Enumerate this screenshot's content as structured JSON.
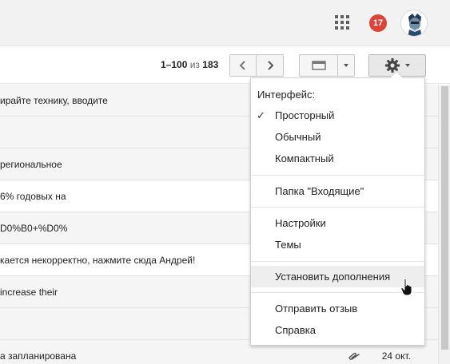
{
  "header": {
    "apps_icon": "apps-grid-icon",
    "notification_count": "17",
    "avatar_icon": "user-avatar"
  },
  "toolbar": {
    "range": "1–100",
    "of": "из",
    "total": "183",
    "prev_icon": "chevron-left-icon",
    "next_icon": "chevron-right-icon",
    "density_icon": "display-density-icon",
    "settings_icon": "gear-icon"
  },
  "mail_rows": [
    {
      "snippet": "ирайте технику, вводите",
      "date": ""
    },
    {
      "snippet": "",
      "date": ""
    },
    {
      "snippet": " региональное",
      "date": ""
    },
    {
      "snippet": "6% годовых на",
      "date": ""
    },
    {
      "snippet": "D0%B0+%D0%",
      "date": ""
    },
    {
      "snippet": "кается некорректно, нажмите сюда Андрей!",
      "date": ""
    },
    {
      "snippet": " increase their",
      "date": ""
    },
    {
      "snippet": "",
      "date": ""
    },
    {
      "snippet": "а запланирована",
      "date": "24 окт."
    }
  ],
  "settings_menu": {
    "heading": "Интерфейс:",
    "density_options": [
      {
        "label": "Просторный",
        "checked": true
      },
      {
        "label": "Обычный",
        "checked": false
      },
      {
        "label": "Компактный",
        "checked": false
      }
    ],
    "inbox_label": "Папка \"Входящие\"",
    "settings_label": "Настройки",
    "themes_label": "Темы",
    "addons_label": "Установить дополнения",
    "feedback_label": "Отправить отзыв",
    "help_label": "Справка",
    "check_glyph": "✓"
  },
  "colors": {
    "badge": "#db4437",
    "menu_hover": "#eeeeee"
  }
}
